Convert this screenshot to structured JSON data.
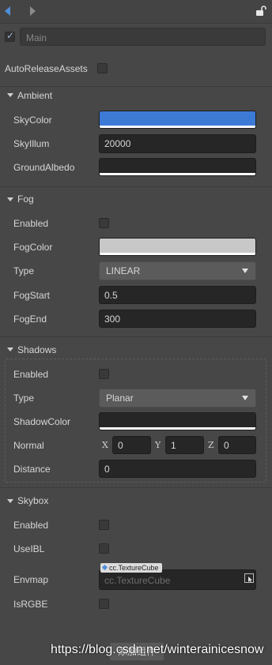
{
  "node": {
    "name_placeholder": "Main",
    "active": true
  },
  "root": {
    "auto_release_label": "AutoReleaseAssets",
    "auto_release_checked": false
  },
  "ambient": {
    "title": "Ambient",
    "sky_color_label": "SkyColor",
    "sky_color": "#3c7ad6",
    "sky_illum_label": "SkyIllum",
    "sky_illum": "20000",
    "ground_albedo_label": "GroundAlbedo",
    "ground_albedo": "#262626"
  },
  "fog": {
    "title": "Fog",
    "enabled_label": "Enabled",
    "enabled": false,
    "fog_color_label": "FogColor",
    "fog_color": "#c8c8c8",
    "type_label": "Type",
    "type_value": "LINEAR",
    "fog_start_label": "FogStart",
    "fog_start": "0.5",
    "fog_end_label": "FogEnd",
    "fog_end": "300"
  },
  "shadows": {
    "title": "Shadows",
    "enabled_label": "Enabled",
    "enabled": false,
    "type_label": "Type",
    "type_value": "Planar",
    "shadow_color_label": "ShadowColor",
    "shadow_color": "#262626",
    "normal_label": "Normal",
    "normal": {
      "x_label": "X",
      "x": "0",
      "y_label": "Y",
      "y": "1",
      "z_label": "Z",
      "z": "0"
    },
    "distance_label": "Distance",
    "distance": "0"
  },
  "skybox": {
    "title": "Skybox",
    "enabled_label": "Enabled",
    "enabled": false,
    "use_ibl_label": "UseIBL",
    "use_ibl": false,
    "envmap_label": "Envmap",
    "envmap_tag": "cc.TextureCube",
    "envmap_placeholder": "cc.TextureCube",
    "is_rgbe_label": "IsRGBE",
    "is_rgbe": false
  },
  "footer": {
    "add_component_label": "添加组件",
    "watermark": "https://blog.csdn.net/winterainicesnow"
  },
  "icons": {
    "back": "back-arrow-icon",
    "forward": "forward-arrow-icon",
    "lock": "lock-icon",
    "collapse": "caret-down-icon",
    "picker": "asset-picker-icon"
  },
  "colors": {
    "accent": "#4e8fd8",
    "panel_bg": "#474747",
    "field_bg": "#262626"
  }
}
